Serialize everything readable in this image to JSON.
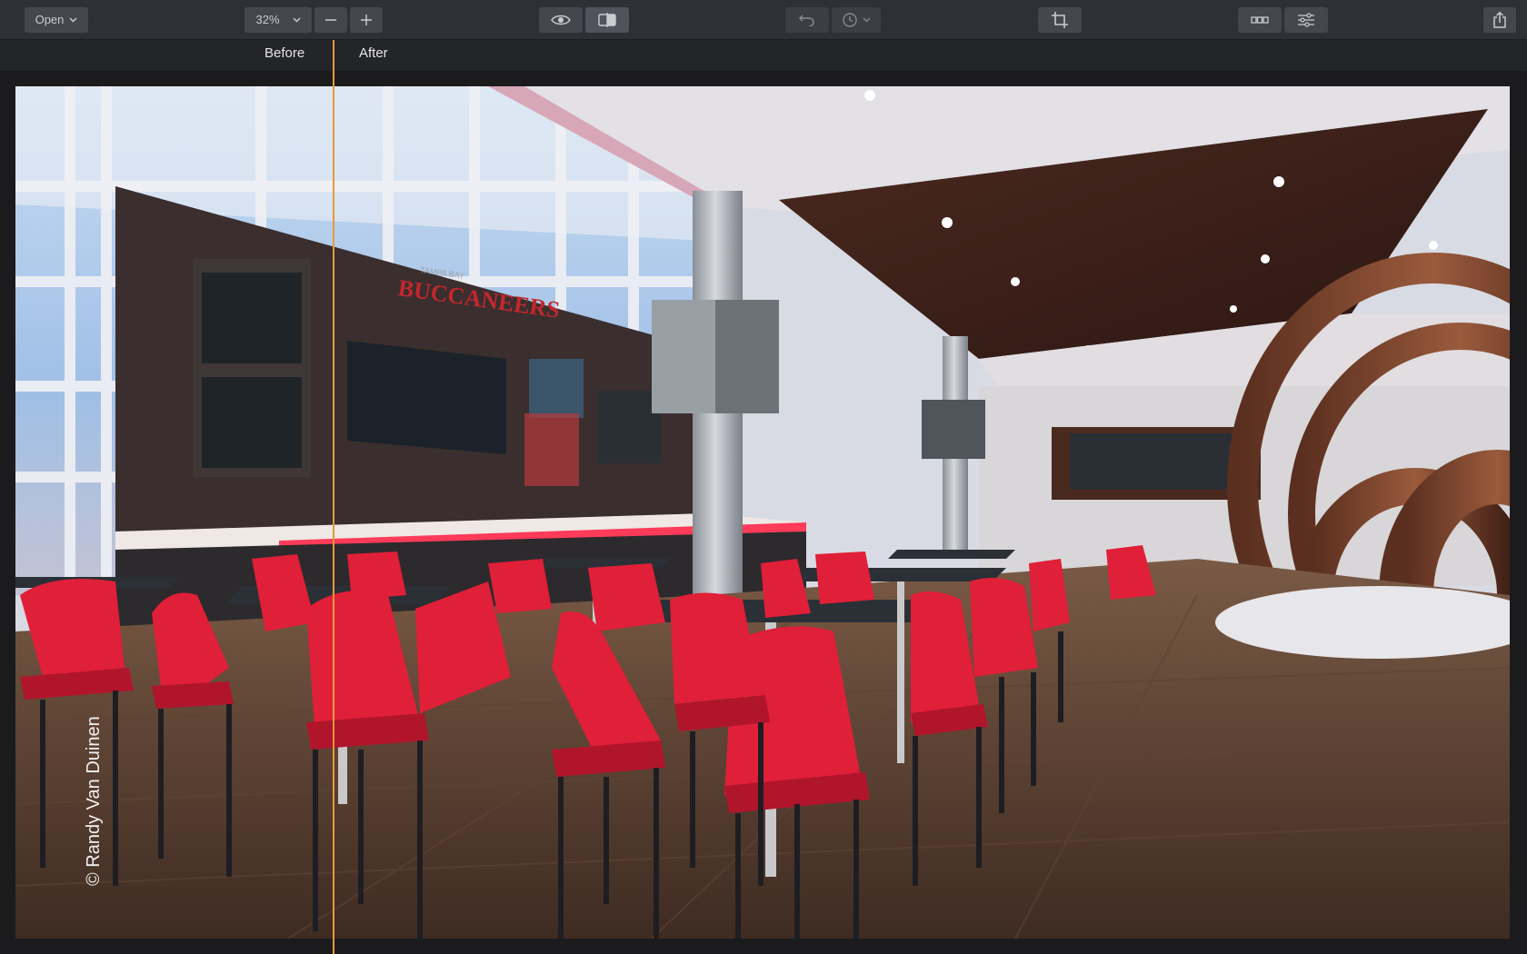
{
  "toolbar": {
    "open_label": "Open",
    "zoom_value": "32%",
    "icons": {
      "chevron": "chevron-down-icon",
      "zoom_out": "minus-icon",
      "zoom_in": "plus-icon",
      "preview": "eye-icon",
      "compare": "split-view-icon",
      "undo": "undo-icon",
      "history": "clock-icon",
      "crop": "crop-icon",
      "filmstrip": "filmstrip-icon",
      "adjust": "sliders-icon",
      "share": "share-icon"
    }
  },
  "compare": {
    "before_label": "Before",
    "after_label": "After",
    "divider_color": "#e59a3a"
  },
  "photo": {
    "watermark": "© Randy Van Duinen",
    "sign_line1": "TAMPA BAY",
    "sign_line2": "BUCCANEERS"
  },
  "colors": {
    "toolbar_bg": "#2e3036",
    "button_bg": "#44474e",
    "accent": "#e59a3a"
  }
}
